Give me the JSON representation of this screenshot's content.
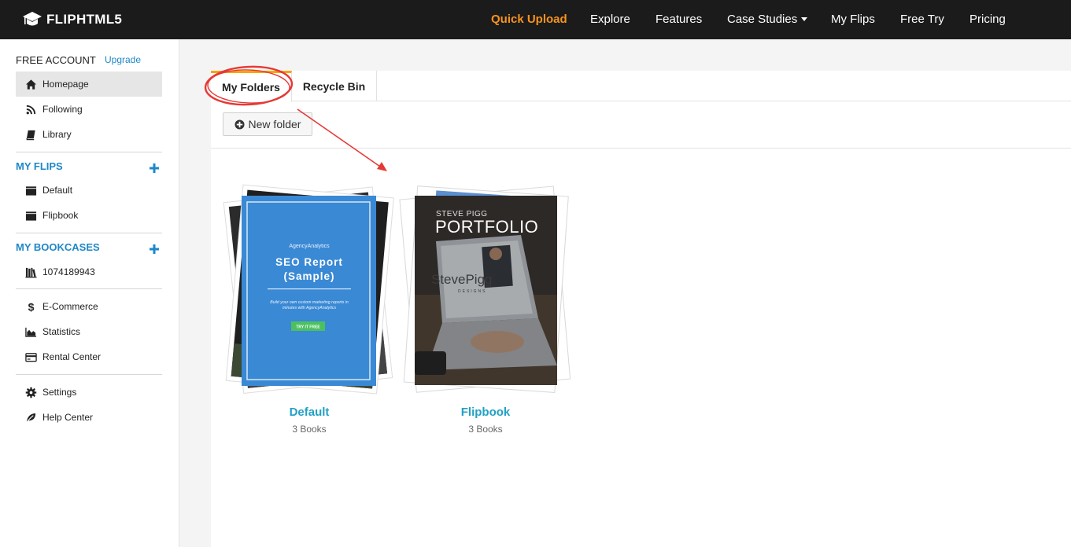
{
  "brand": {
    "name": "FLIPHTML5",
    "logo_icon": "graduation-cap-icon"
  },
  "nav": {
    "items": [
      {
        "label": "Quick Upload",
        "active": true
      },
      {
        "label": "Explore"
      },
      {
        "label": "Features"
      },
      {
        "label": "Case Studies",
        "has_dropdown": true
      },
      {
        "label": "My Flips"
      },
      {
        "label": "Free Try"
      },
      {
        "label": "Pricing"
      }
    ],
    "active_color": "#f7931e"
  },
  "sidebar": {
    "account_label": "FREE ACCOUNT",
    "upgrade_label": "Upgrade",
    "main_items": [
      {
        "label": "Homepage",
        "icon": "home-icon",
        "active": true
      },
      {
        "label": "Following",
        "icon": "rss-icon"
      },
      {
        "label": "Library",
        "icon": "book-icon"
      }
    ],
    "my_flips": {
      "title": "MY FLIPS",
      "items": [
        {
          "label": "Default",
          "icon": "folder-icon"
        },
        {
          "label": "Flipbook",
          "icon": "folder-icon"
        }
      ]
    },
    "my_bookcases": {
      "title": "MY BOOKCASES",
      "items": [
        {
          "label": "1074189943",
          "icon": "bookcase-icon"
        }
      ]
    },
    "tools": [
      {
        "label": "E-Commerce",
        "icon": "dollar-icon"
      },
      {
        "label": "Statistics",
        "icon": "area-chart-icon"
      },
      {
        "label": "Rental Center",
        "icon": "credit-card-icon"
      }
    ],
    "help": [
      {
        "label": "Settings",
        "icon": "gear-icon"
      },
      {
        "label": "Help Center",
        "icon": "leaf-icon"
      }
    ],
    "section_color": "#1e88c7"
  },
  "main": {
    "tabs": [
      {
        "label": "My Folders",
        "active": true
      },
      {
        "label": "Recycle Bin"
      }
    ],
    "new_folder_label": "New folder",
    "folders": [
      {
        "name": "Default",
        "count": "3 Books",
        "cover": {
          "brand_small": "AgencyAnalytics",
          "title": "SEO Report (Sample)",
          "subtitle": "Build your own custom marketing reports in minutes with AgencyAnalytics",
          "cta": "TRY IT FREE"
        }
      },
      {
        "name": "Flipbook",
        "count": "3 Books",
        "cover": {
          "small_title": "STEVE PIGG",
          "title": "PORTFOLIO",
          "brand": "StevePigg",
          "brand_sub": "DESIGNS"
        }
      }
    ],
    "folder_name_color": "#22a0c5"
  },
  "annotation_color": "#e53935"
}
